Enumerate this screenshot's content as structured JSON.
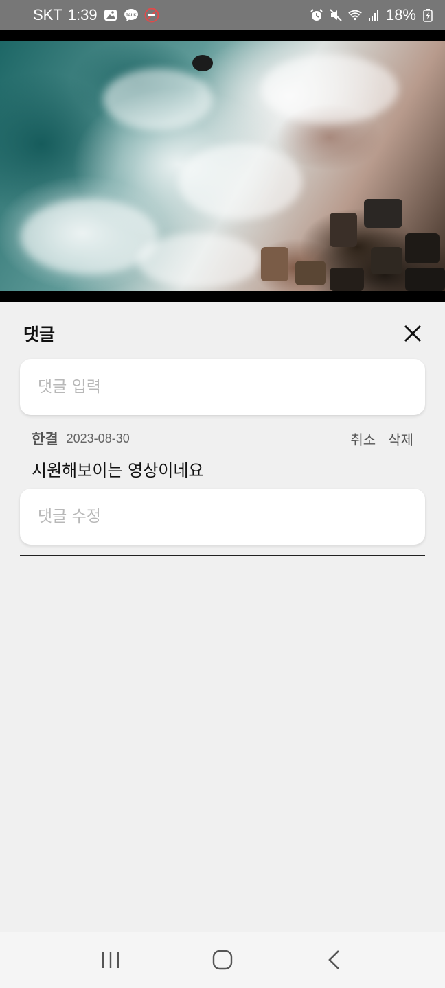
{
  "status_bar": {
    "carrier": "SKT",
    "time": "1:39",
    "battery": "18%",
    "left_icons": [
      "gallery-icon",
      "talk-icon",
      "no-smoking-icon"
    ],
    "right_icons": [
      "alarm-icon",
      "mute-icon",
      "wifi-icon",
      "signal-icon",
      "battery-charging-icon"
    ]
  },
  "video": {
    "description_icon": "ocean-video-thumbnail"
  },
  "comments_panel": {
    "title": "댓글",
    "close_icon": "close-icon",
    "new_comment": {
      "placeholder": "댓글 입력",
      "value": ""
    },
    "comments": [
      {
        "author": "한결",
        "date": "2023-08-30",
        "cancel_label": "취소",
        "delete_label": "삭제",
        "text": "시원해보이는 영상이네요",
        "edit_placeholder": "댓글 수정",
        "edit_value": ""
      }
    ]
  },
  "nav_bar": {
    "recent_icon": "recent-apps-icon",
    "home_icon": "home-icon",
    "back_icon": "back-icon"
  },
  "colors": {
    "status_bar_bg": "#777777",
    "panel_bg": "#f0f0f0",
    "input_bg": "#ffffff",
    "placeholder": "#b8b8b8"
  }
}
